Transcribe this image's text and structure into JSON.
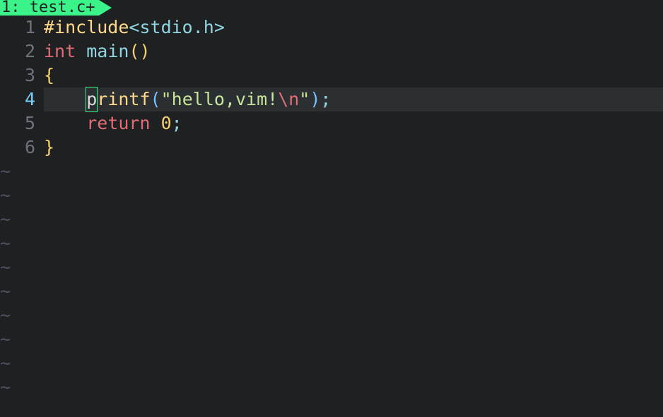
{
  "tab": {
    "index": "1:",
    "name": "test.c",
    "mod": "+"
  },
  "lines": {
    "l1": {
      "n": "1",
      "include": "#include",
      "header": "<stdio.h>"
    },
    "l2": {
      "n": "2",
      "int": "int ",
      "main": "main",
      "paren": "()"
    },
    "l3": {
      "n": "3",
      "brace": "{"
    },
    "l4": {
      "n": "4",
      "indent": "    ",
      "cursor": "p",
      "rest": "rintf",
      "po": "(",
      "q1": "\"",
      "str": "hello,vim!",
      "esc": "\\n",
      "q2": "\"",
      "pc": ")",
      "semi": ";"
    },
    "l5": {
      "n": "5",
      "indent": "    ",
      "ret": "return ",
      "zero": "0",
      "semi": ";"
    },
    "l6": {
      "n": "6",
      "brace": "}"
    }
  },
  "tilde": "~"
}
